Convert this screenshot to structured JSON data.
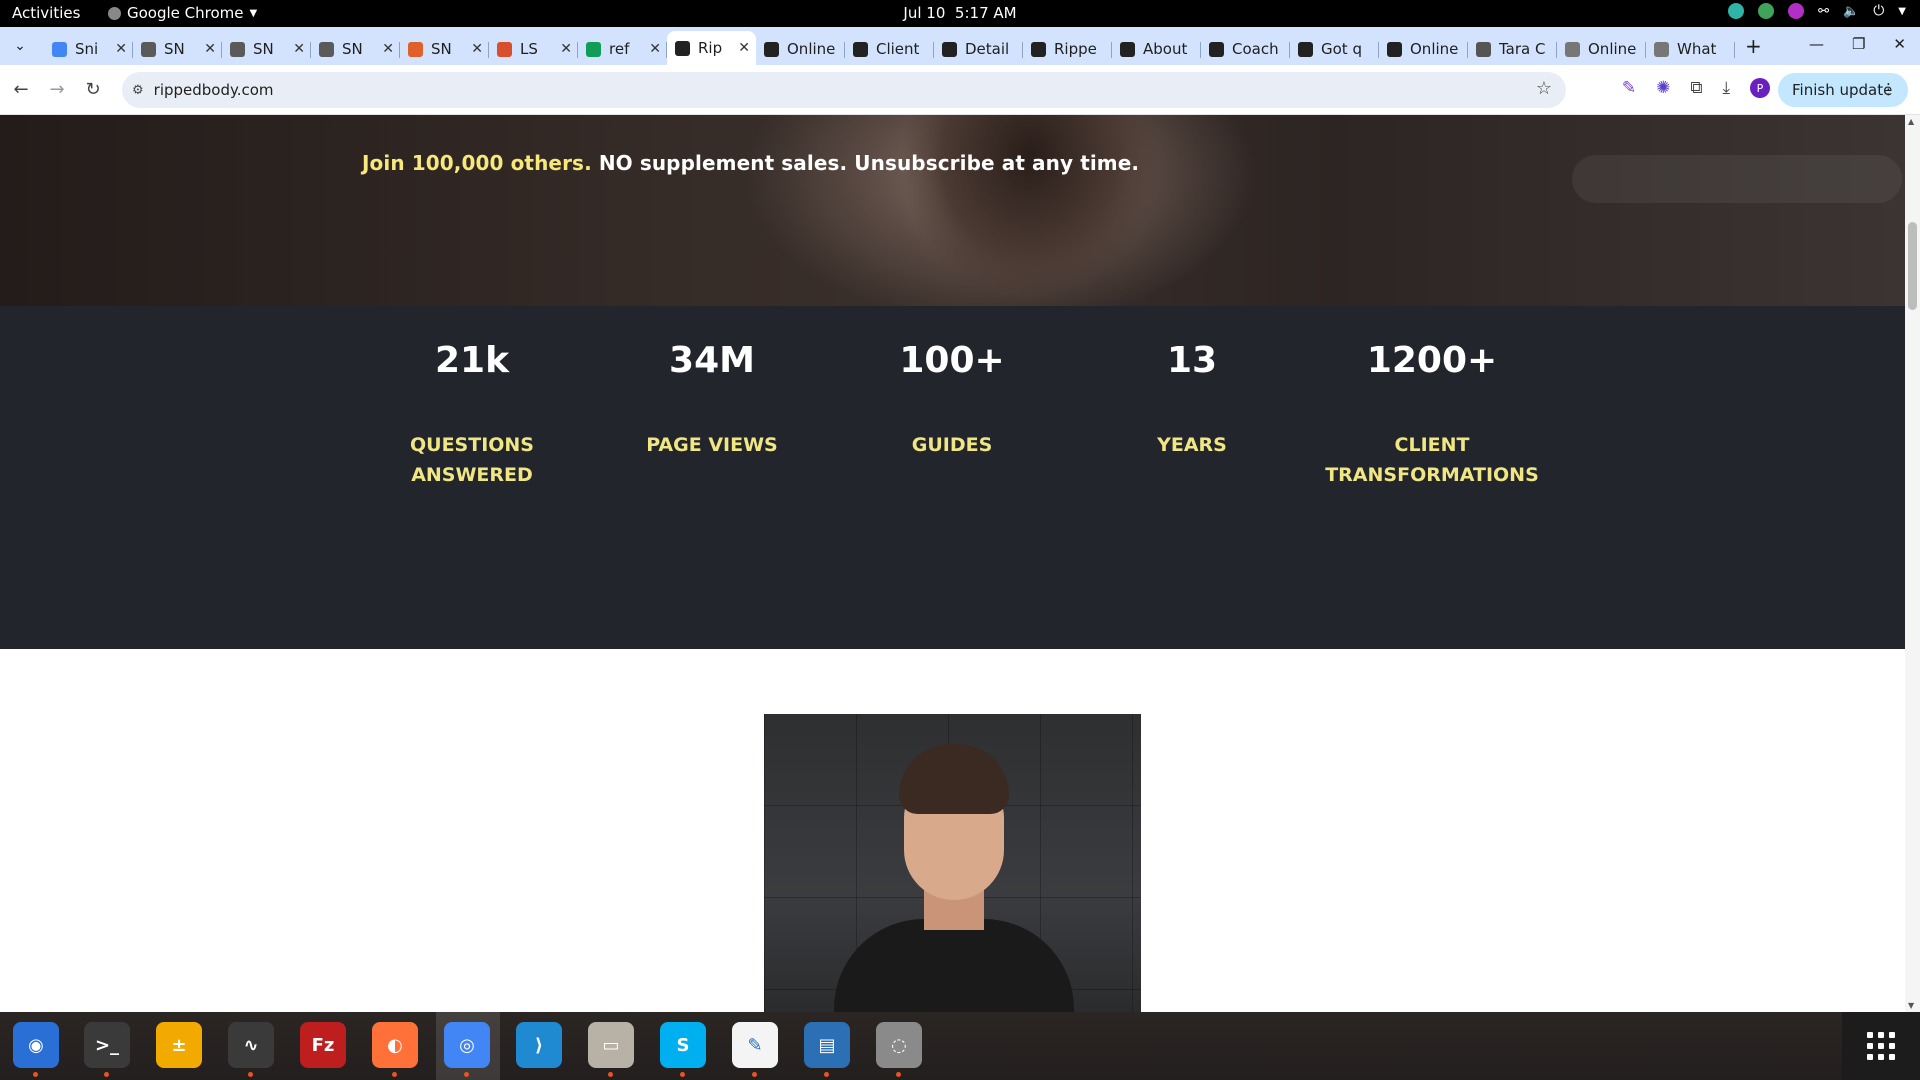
{
  "topbar": {
    "activities": "Activities",
    "app_name": "Google Chrome",
    "date": "Jul 10",
    "time": "5:17 AM"
  },
  "tabs": [
    {
      "title": "Sni",
      "icon": "docs-icon",
      "color": "#4285f4"
    },
    {
      "title": "SN",
      "icon": "snp-icon",
      "color": "#5a5a5a"
    },
    {
      "title": "SN",
      "icon": "snp-icon",
      "color": "#5a5a5a"
    },
    {
      "title": "SN",
      "icon": "snp-icon",
      "color": "#5a5a5a"
    },
    {
      "title": "SN",
      "icon": "emoji-icon",
      "color": "#e0602a"
    },
    {
      "title": "LS",
      "icon": "ls-icon",
      "color": "#d94e2b"
    },
    {
      "title": "ref",
      "icon": "sheets-icon",
      "color": "#0f9d58"
    },
    {
      "title": "Rip",
      "icon": "rippedbody-icon",
      "color": "#222222",
      "active": true
    },
    {
      "title": "Online",
      "icon": "rippedbody-icon",
      "color": "#222222"
    },
    {
      "title": "Client",
      "icon": "rippedbody-icon",
      "color": "#222222"
    },
    {
      "title": "Detail",
      "icon": "rippedbody-icon",
      "color": "#222222"
    },
    {
      "title": "Rippe",
      "icon": "rippedbody-icon",
      "color": "#222222"
    },
    {
      "title": "About",
      "icon": "rippedbody-icon",
      "color": "#222222"
    },
    {
      "title": "Coach",
      "icon": "rippedbody-icon",
      "color": "#222222"
    },
    {
      "title": "Got q",
      "icon": "rippedbody-icon",
      "color": "#222222"
    },
    {
      "title": "Online",
      "icon": "rippedbody-icon",
      "color": "#222222"
    },
    {
      "title": "Tara C",
      "icon": "globe-icon",
      "color": "#555555"
    },
    {
      "title": "Online",
      "icon": "page-icon",
      "color": "#777777"
    },
    {
      "title": "What",
      "icon": "page-icon",
      "color": "#777777"
    }
  ],
  "toolbar": {
    "url": "rippedbody.com",
    "finish_update": "Finish update",
    "avatar_letter": "P"
  },
  "hero": {
    "tagline_highlight": "Join 100,000 others.",
    "tagline_rest": " NO supplement sales. Unsubscribe at any time."
  },
  "stats": [
    {
      "number": "21k",
      "label": "QUESTIONS ANSWERED"
    },
    {
      "number": "34M",
      "label": "PAGE VIEWS"
    },
    {
      "number": "100+",
      "label": "GUIDES"
    },
    {
      "number": "13",
      "label": "YEARS"
    },
    {
      "number": "1200+",
      "label": "CLIENT TRANSFORMATIONS"
    }
  ],
  "colors": {
    "accent_yellow": "#f0e683",
    "stats_bg": "#22252b",
    "scroll_top_btn": "#2f8fd6"
  },
  "dock": [
    {
      "name": "thunderbird-icon",
      "color": "#2a6fd6"
    },
    {
      "name": "terminal-icon",
      "color": "#3a3a3a"
    },
    {
      "name": "calculator-icon",
      "color": "#f2a900"
    },
    {
      "name": "system-monitor-icon",
      "color": "#3a3a3a"
    },
    {
      "name": "filezilla-icon",
      "color": "#bf1e1e"
    },
    {
      "name": "firefox-icon",
      "color": "#ff7139"
    },
    {
      "name": "chrome-icon",
      "color": "#4285f4"
    },
    {
      "name": "vscode-icon",
      "color": "#1f8ad2"
    },
    {
      "name": "files-icon",
      "color": "#b8b2a6"
    },
    {
      "name": "skype-icon",
      "color": "#00aff0"
    },
    {
      "name": "text-editor-icon",
      "color": "#f4f4f4"
    },
    {
      "name": "writer-icon",
      "color": "#2b6fb5"
    },
    {
      "name": "disks-icon",
      "color": "#8a8a8a"
    }
  ]
}
